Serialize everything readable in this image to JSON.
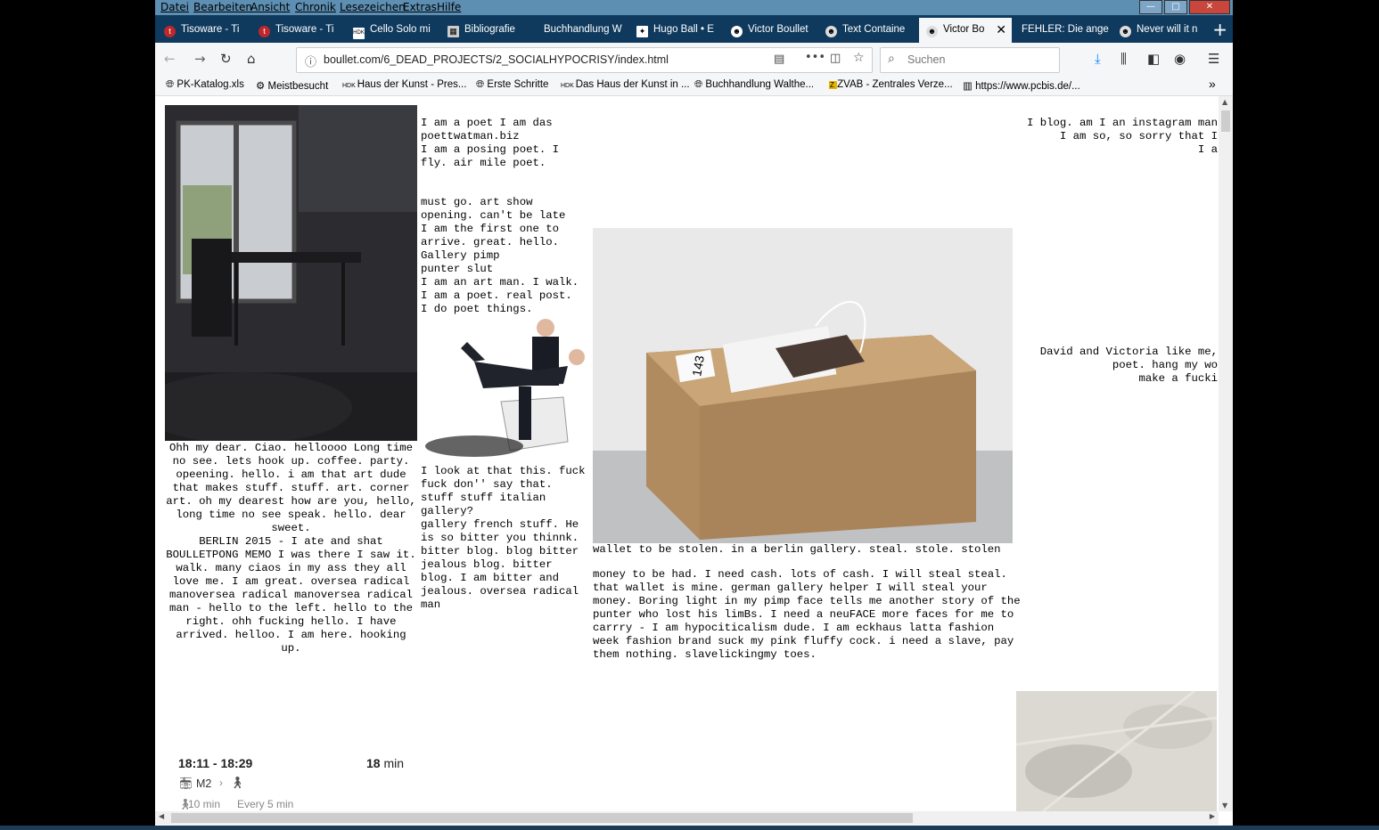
{
  "menu": [
    "Datei",
    "Bearbeiten",
    "Ansicht",
    "Chronik",
    "Lesezeichen",
    "Extras",
    "Hilfe"
  ],
  "tabs": [
    {
      "label": "Tisoware - Ti",
      "icon": "red"
    },
    {
      "label": "Tisoware - Ti",
      "icon": "red"
    },
    {
      "label": "Cello Solo mi",
      "icon": "hdk"
    },
    {
      "label": "Bibliografie",
      "icon": "grid"
    },
    {
      "label": "Buchhandlung W",
      "icon": "none"
    },
    {
      "label": "Hugo Ball • E",
      "icon": "puzzle"
    },
    {
      "label": "Victor Boullet",
      "icon": "face"
    },
    {
      "label": "Text Containe",
      "icon": "face"
    },
    {
      "label": "Victor Bo",
      "icon": "face",
      "active": true
    },
    {
      "label": "FEHLER: Die ange",
      "icon": "none"
    },
    {
      "label": "Never will it n",
      "icon": "face"
    }
  ],
  "url": "boullet.com/6_DEAD_PROJECTS/2_SOCIALHYPOCRISY/index.html",
  "search_placeholder": "Suchen",
  "bookmarks": [
    "PK-Katalog.xls",
    "Meistbesucht",
    "Haus der Kunst - Pres...",
    "Erste Schritte",
    "Das Haus der Kunst in ...",
    "Buchhandlung Walthe...",
    "ZVAB - Zentrales Verze...",
    "https://www.pcbis.de/..."
  ],
  "page": {
    "col2_top": "I am a poet I am das\npoettwatman.biz\nI am a posing poet. I\nfly. air mile poet.",
    "col2_mid": "must go. art show\nopening. can't be late\nI am the first one to\narrive. great. hello.\nGallery pimp\npunter slut\nI am an art man. I walk.\nI am a poet. real post.\nI do poet things.",
    "col1_text": "Ohh my dear. Ciao. helloooo Long time no see. lets hook up. coffee. party. opeening. hello. i am that art dude that makes stuff. stuff. art. corner art. oh my dearest how are you, hello, long time no see speak. hello. dear sweet.\nBERLIN 2015 - I ate and shat BOULLETPONG MEMO I was there I saw it. walk. many ciaos in my ass they all love me. I am great. oversea radical manoversea radical manoversea radical man - hello to the left. hello to the right. ohh fucking hello. I have arrived. helloo. I am here. hooking up.",
    "col2_bottom": "I look at that this. fuck fuck don'' say that. stuff stuff italian gallery?\ngallery french stuff. He is so bitter you thinnk. bitter blog. blog bitter jealous blog. bitter blog. I am bitter and jealous. oversea radical man",
    "col3_caption": "wallet to be stolen. in a berlin gallery. steal. stole. stolen",
    "col3_text": "money to be had. I need cash. lots of cash. I will steal steal. that wallet is mine. german gallery helper I will steal your money. Boring light in my pimp face tells me another story of the punter who lost his limBs. I need a neuFACE more faces for me to carrry - I am hypociticalism dude. I am eckhaus latta fashion week fashion brand suck my pink fluffy cock. i need a slave, pay them nothing. slavelickingmy toes.",
    "col4_top": "I blog. am I an instagram man\nI am so, so sorry that I\nI a",
    "col4_mid": "David and Victoria like me,\npoet. hang my wo\nmake a fucki",
    "box_label": "143"
  },
  "transit": {
    "time": "18:11 - 18:29",
    "duration_num": "18",
    "duration_unit": "min",
    "line": "M2",
    "walk": "10 min",
    "freq": "Every 5 min"
  }
}
